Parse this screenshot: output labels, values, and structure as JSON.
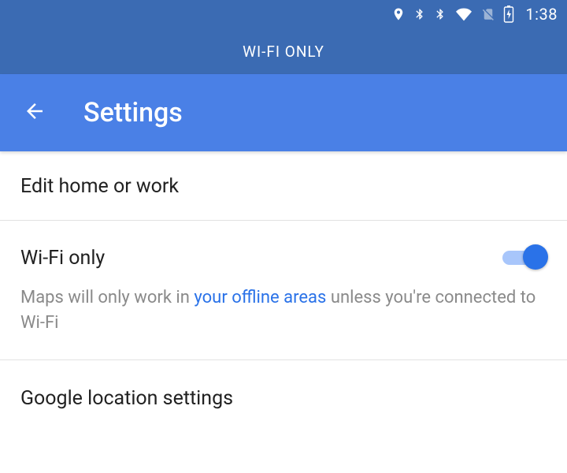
{
  "status": {
    "time": "1:38"
  },
  "banner": {
    "label": "WI-FI ONLY"
  },
  "appbar": {
    "title": "Settings"
  },
  "rows": {
    "edit": {
      "title": "Edit home or work"
    },
    "wifi": {
      "title": "Wi-Fi only",
      "sub_pre": "Maps will only work in ",
      "sub_link": "your offline areas",
      "sub_post": " unless you're connected to Wi-Fi",
      "toggle_on": true
    },
    "location": {
      "title": "Google location settings"
    }
  }
}
